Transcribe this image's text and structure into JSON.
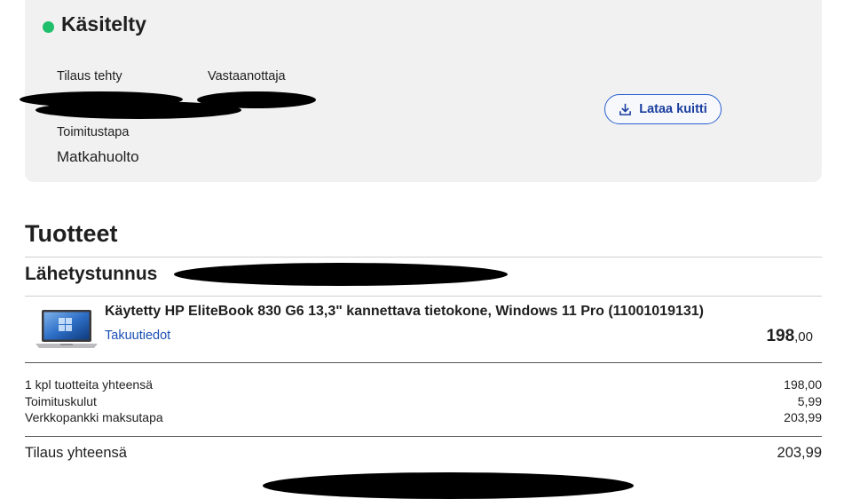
{
  "order_status": {
    "title": "Käsitelty",
    "status_color": "#1fbf6b",
    "fields": {
      "order_made_label": "Tilaus tehty",
      "recipient_label": "Vastaanottaja",
      "delivery_method_label": "Toimitustapa",
      "delivery_method_value": "Matkahuolto"
    },
    "receipt_button": {
      "label": "Lataa kuitti",
      "icon": "download-icon"
    }
  },
  "products": {
    "title": "Tuotteet",
    "shipment_label": "Lähetystunnus",
    "items": [
      {
        "name": "Käytetty HP EliteBook 830 G6 13,3\" kannettava tietokone, Windows 11 Pro (11001019131)",
        "warranty_link": "Takuutiedot",
        "price_whole": "198",
        "price_decimal": ",00",
        "image": "laptop-image"
      }
    ]
  },
  "summary": {
    "rows": [
      {
        "label": "1 kpl tuotteita yhteensä",
        "value": "198,00"
      },
      {
        "label": "Toimituskulut",
        "value": "5,99"
      },
      {
        "label": "Verkkopankki maksutapa",
        "value": "203,99"
      }
    ],
    "total_label": "Tilaus yhteensä",
    "total_value": "203,99"
  }
}
